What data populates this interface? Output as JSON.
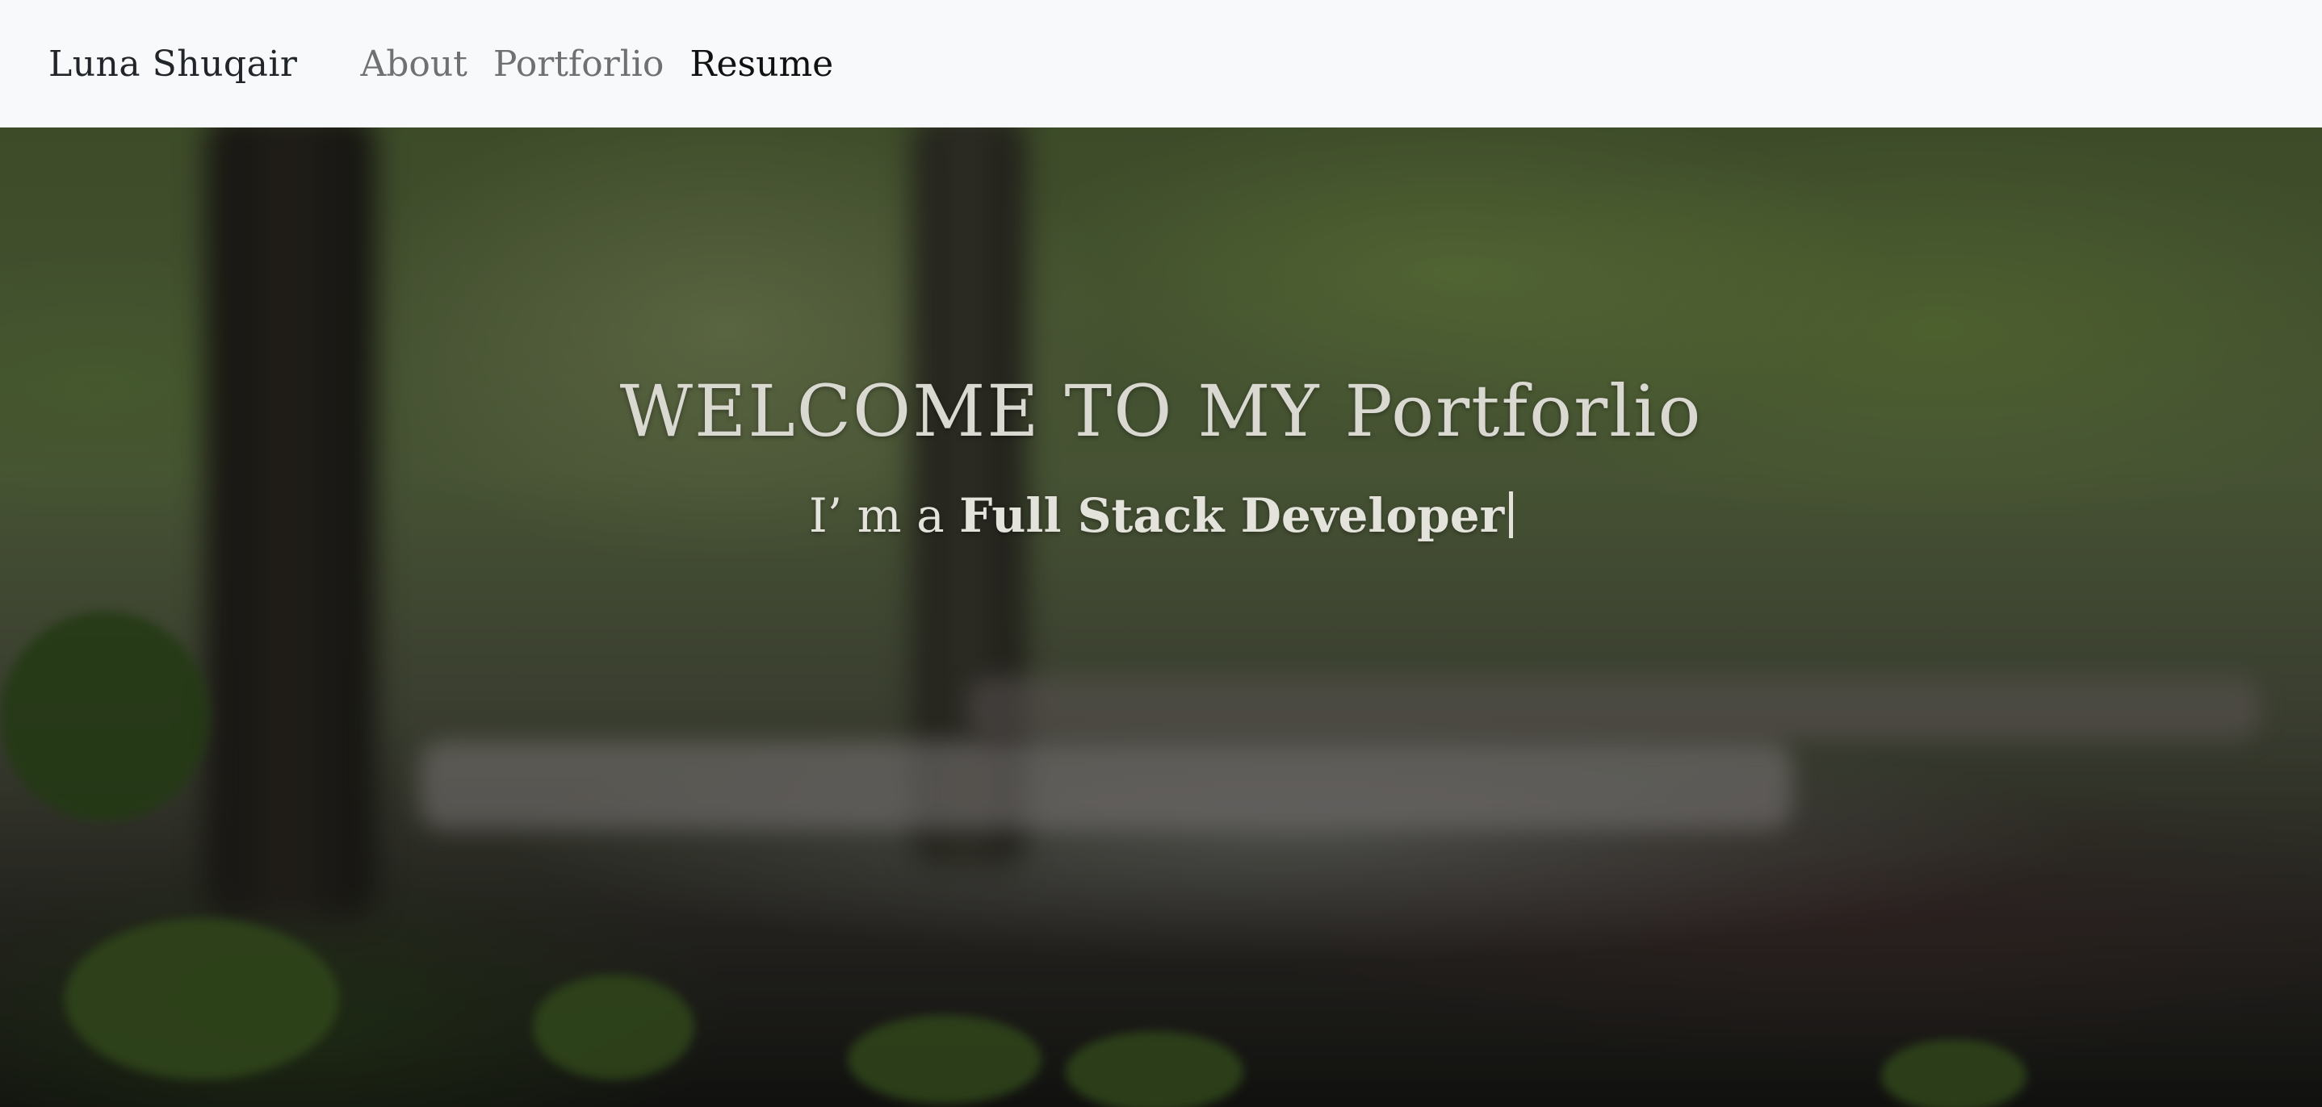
{
  "navbar": {
    "brand": "Luna Shuqair",
    "links": [
      {
        "label": "About"
      },
      {
        "label": "Portforlio"
      },
      {
        "label": "Resume"
      }
    ]
  },
  "hero": {
    "title": "WELCOME TO MY Portforlio",
    "subtitle_prefix": "I’ m a ",
    "typed_text": "Full Stack Developer",
    "background_image": "blurred-forest-photo"
  },
  "colors": {
    "navbar_bg": "#f8f9fa",
    "brand": "#212529",
    "nav_link": "#757575",
    "nav_link_active": "#111111",
    "hero_text": "#d9d9d2"
  }
}
